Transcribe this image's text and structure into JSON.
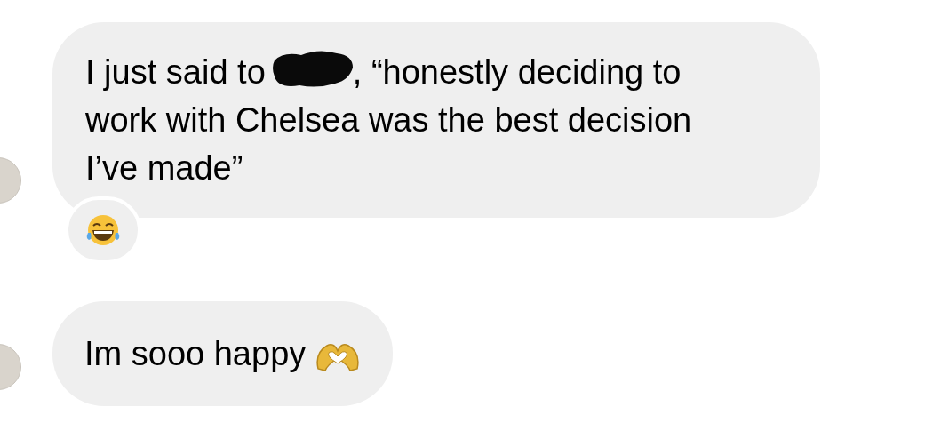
{
  "messages": [
    {
      "kind": "text",
      "first_line": {
        "text_before": "I just said to",
        "redacted": true,
        "text_after": ", “honestly deciding to"
      },
      "more_lines": [
        "work with Chelsea was the best decision",
        "I’ve made”"
      ],
      "reacted": true,
      "ends_with_emoji": false
    },
    {
      "kind": "text",
      "first_line": {
        "text_before": "Im sooo happy",
        "redacted": false
      },
      "reacted": false,
      "ends_with_emoji": true
    }
  ]
}
